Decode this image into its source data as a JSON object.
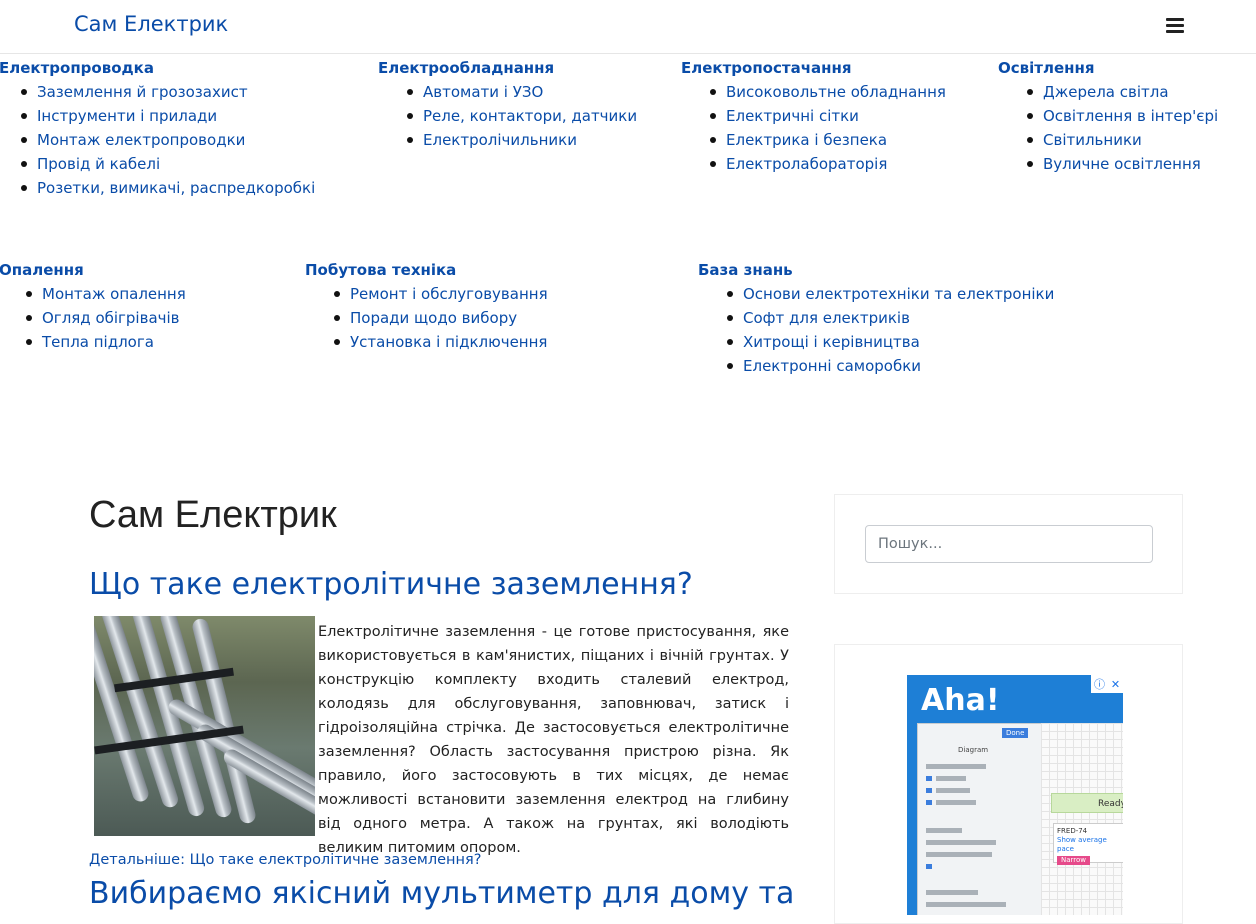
{
  "navbar": {
    "brand": "Сам Електрик",
    "menu_icon": "hamburger-menu-icon"
  },
  "menu": {
    "groups": [
      {
        "title": "Електропроводка",
        "items": [
          "Заземлення й грозозахист",
          "Інструменти і прилади",
          "Монтаж електропроводки",
          "Провід й кабелі",
          "Розетки, вимикачі, распредкоробкі"
        ]
      },
      {
        "title": "Електрообладнання",
        "items": [
          "Автомати і УЗО",
          "Реле, контактори, датчики",
          "Електролічильники"
        ]
      },
      {
        "title": "Електропостачання",
        "items": [
          "Високовольтне обладнання",
          "Електричні сітки",
          "Електрика і безпека",
          "Електролабораторія"
        ]
      },
      {
        "title": "Освітлення",
        "items": [
          "Джерела світла",
          "Освітлення в інтер'єрі",
          "Світильники",
          "Вуличне освітлення"
        ]
      },
      {
        "title": "Опалення",
        "items": [
          "Монтаж опалення",
          "Огляд обігрівачів",
          "Тепла підлога"
        ]
      },
      {
        "title": "Побутова техніка",
        "items": [
          "Ремонт і обслуговування",
          "Поради щодо вибору",
          "Установка і підключення"
        ]
      },
      {
        "title": "База знань",
        "items": [
          "Основи електротехніки та електроніки",
          "Софт для електриків",
          "Хитрощі і керівництва",
          "Електронні саморобки"
        ]
      }
    ]
  },
  "main": {
    "page_title": "Сам Електрик",
    "articles": [
      {
        "title": "Що таке електролітичне заземлення?",
        "text": "Електролітичне заземлення - це готове пристосування, яке використовується в кам'янистих, піщаних і вічній грунтах. У конструкцію комплекту входить сталевий електрод, колодязь для обслуговування, заповнювач, затиск і гідроізоляційна стрічка. Де застосовується електролітичне заземлення? Область застосування пристрою різна. Як правило, його застосовують в тих місцях, де немає можливості встановити заземлення електрод на глибину від одного метра. А також на грунтах, які володіють великим питомим опором.",
        "read_more": "Детальніше: Що таке електролітичне заземлення?"
      },
      {
        "title": "Вибираємо якісний мультиметр для дому та"
      }
    ]
  },
  "sidebar": {
    "search_placeholder": "Пошук...",
    "ad": {
      "headline": "Aha!",
      "button_label": "Done",
      "panel_label": "Diagram",
      "ready_label": "Ready",
      "note_title": "FRED-74",
      "note_text": "Show average pace",
      "note_button": "Narrow"
    }
  }
}
